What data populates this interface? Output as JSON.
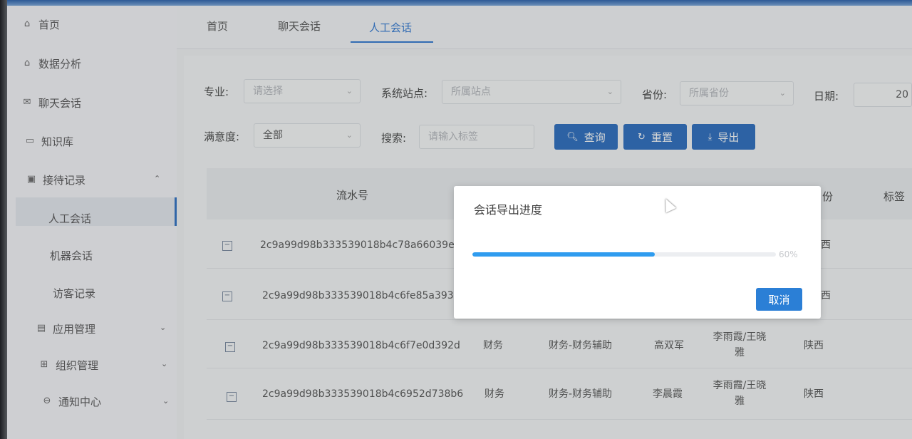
{
  "sidebar": {
    "items": [
      {
        "label": "首页",
        "icon": "home-icon"
      },
      {
        "label": "数据分析",
        "icon": "home-icon"
      },
      {
        "label": "聊天会话",
        "icon": "mail-icon"
      },
      {
        "label": "知识库",
        "icon": "book-icon"
      },
      {
        "label": "接待记录",
        "icon": "record-icon"
      },
      {
        "label": "应用管理",
        "icon": "app-icon"
      },
      {
        "label": "组织管理",
        "icon": "org-icon"
      },
      {
        "label": "通知中心",
        "icon": "bell-icon"
      }
    ],
    "sub_items": [
      {
        "label": "人工会话"
      },
      {
        "label": "机器会话"
      },
      {
        "label": "访客记录"
      }
    ]
  },
  "tabs": [
    {
      "label": "首页"
    },
    {
      "label": "聊天会话"
    },
    {
      "label": "人工会话"
    }
  ],
  "filters": {
    "major_label": "专业:",
    "major_placeholder": "请选择",
    "site_label": "系统站点:",
    "site_placeholder": "所属站点",
    "province_label": "省份:",
    "province_placeholder": "所属省份",
    "date_label": "日期:",
    "date_value": "20",
    "satisfaction_label": "满意度:",
    "satisfaction_value": "全部",
    "search_label": "搜索:",
    "search_placeholder": "请输入标签"
  },
  "buttons": {
    "query": "查询",
    "reset": "重置",
    "export": "导出"
  },
  "table": {
    "headers": {
      "serial": "流水号",
      "province": "份",
      "tag": "标签"
    },
    "rows": [
      {
        "id": "2c9a99d98b333539018b4c78a66039e5",
        "major": "",
        "site": "",
        "agent": "",
        "visitor": "",
        "province": "西"
      },
      {
        "id": "2c9a99d98b333539018b4c6fe85a3937",
        "major": "",
        "site": "",
        "agent": "",
        "visitor": "",
        "province": "西"
      },
      {
        "id": "2c9a99d98b333539018b4c6f7e0d392d",
        "major": "财务",
        "site": "财务-财务辅助",
        "agent": "高双军",
        "visitor": "李雨霞/王晓雅",
        "province": "陕西"
      },
      {
        "id": "2c9a99d98b333539018b4c6952d738b6",
        "major": "财务",
        "site": "财务-财务辅助",
        "agent": "李晨霞",
        "visitor": "李雨霞/王晓雅",
        "province": "陕西"
      }
    ]
  },
  "dialog": {
    "title": "会话导出进度",
    "progress": 60,
    "progress_text": "60%",
    "cancel": "取消"
  },
  "colors": {
    "primary": "#2a6cc0",
    "progress": "#2f9cef",
    "tab_active": "#2f78d4"
  }
}
